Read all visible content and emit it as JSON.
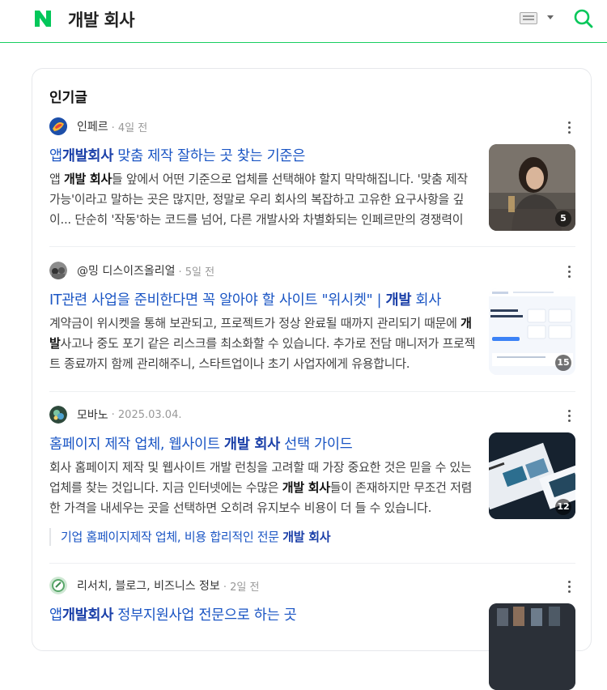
{
  "header": {
    "query": "개발 회사",
    "brand_color": "#03c75a"
  },
  "section": {
    "title": "인기글"
  },
  "posts": [
    {
      "source": "인페르",
      "time": "4일 전",
      "title_parts": [
        "앱",
        "개발회사",
        " 맞춤 제작 잘하는 곳 찾는 기준은"
      ],
      "desc_html_parts": [
        "앱 ",
        "개발 회사",
        "들 앞에서 어떤 기준으로 업체를 선택해야 할지 막막해집니다. '맞춤 제작 가능'이라고 말하는 곳은 많지만, 정말로 우리 회사의 복잡하고 고유한 요구사항을 깊이... 단순히 '작동'하는 코드를 넘어, 다른 개발사와 차별화되는 인페르만의 경쟁력이 무엇인지 알아보세요."
      ],
      "image_count": "5"
    },
    {
      "source": "@밍 디스이즈올리얼",
      "time": "5일 전",
      "title_parts": [
        "IT관련 사업을 준비한다면 꼭 알아야 할 사이트 \"위시켓\" | ",
        "개발",
        " 회사"
      ],
      "desc_html_parts": [
        "계약금이 위시켓을 통해 보관되고, 프로젝트가 정상 완료될 때까지 관리되기 때문에 ",
        "개발",
        "사고나 중도 포기 같은 리스크를 최소화할 수 있습니다. 추가로 전담 매니저가 프로젝트 종료까지 함께 관리해주니, 스타트업이나 초기 사업자에게 유용합니다."
      ],
      "image_count": "15"
    },
    {
      "source": "모바노",
      "time": "2025.03.04.",
      "title_parts": [
        "홈페이지 제작 업체, 웹사이트 ",
        "개발 회사",
        " 선택 가이드"
      ],
      "desc_html_parts": [
        "회사 홈페이지 제작 및 웹사이트 개발 런칭을 고려할 때 가장 중요한 것은 믿을 수 있는 업체를 찾는 것입니다. 지금 인터넷에는 수많은 ",
        "개발 회사",
        "들이 존재하지만 무조건 저렴한 가격을 내세우는 곳을 선택하면 오히려 유지보수 비용이 더 들 수 있습니다."
      ],
      "image_count": "12",
      "sublink_parts": [
        "기업 홈페이지제작 업체, 비용 합리적인 전문 ",
        "개발 회사"
      ]
    },
    {
      "source": "리서치, 블로그, 비즈니스 정보",
      "time": "2일 전",
      "title_parts": [
        "앱",
        "개발회사",
        " 정부지원사업 전문으로 하는 곳"
      ]
    }
  ]
}
